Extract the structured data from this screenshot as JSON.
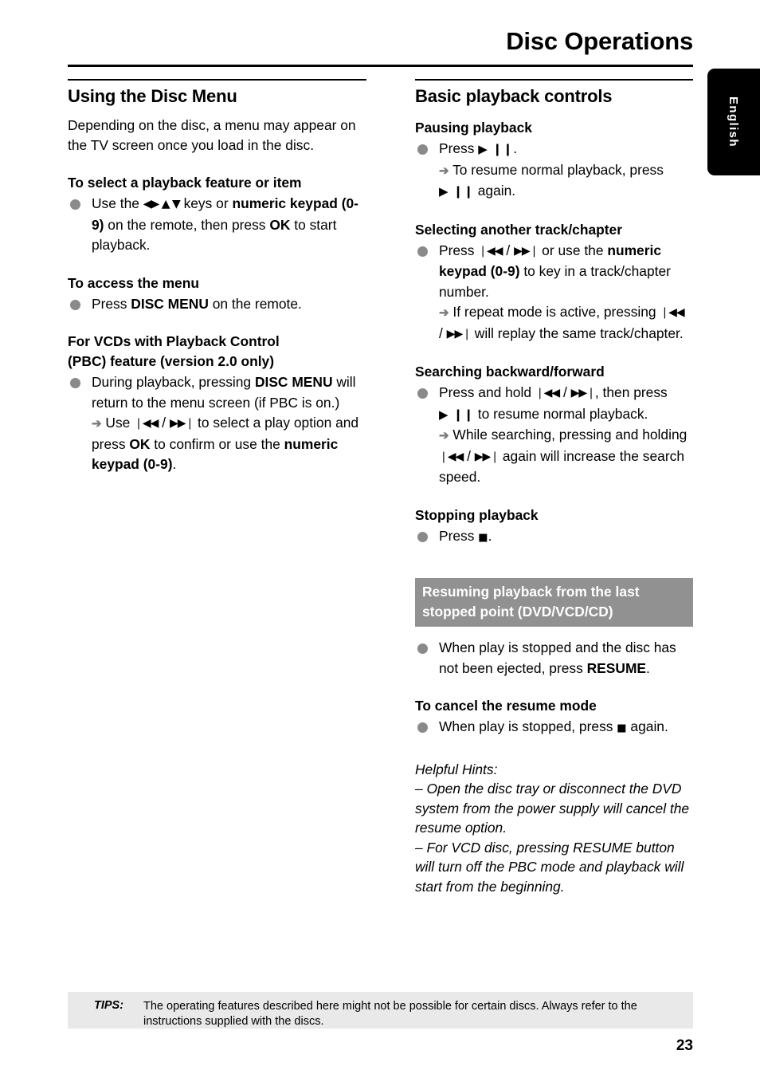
{
  "header": {
    "title": "Disc Operations"
  },
  "language_tab": {
    "label": "English"
  },
  "left_column": {
    "heading": "Using the Disc Menu",
    "intro": "Depending on the disc, a menu may appear on the TV screen once you load in the disc.",
    "sections": [
      {
        "heading": "To select a playback feature or item",
        "bullet_prefix": "Use the ",
        "keys_symbols": "◀▶ ▲ ▼",
        "bullet_mid": " keys or ",
        "bold_1": "numeric keypad (0-9)",
        "bullet_mid_2": " on the remote, then press ",
        "bold_2": "OK",
        "bullet_suffix": " to start playback."
      },
      {
        "heading": "To access the menu",
        "bullet_prefix": "Press ",
        "bold_1": "DISC MENU",
        "bullet_suffix": " on the remote."
      },
      {
        "heading_line_1": "For VCDs with Playback Control",
        "heading_line_2": "(PBC) feature (version 2.0 only)",
        "bullet_prefix": "During playback, pressing ",
        "bold_1": "DISC MENU",
        "bullet_mid": " will return to the menu screen (if PBC is on.)",
        "arrow": "➔",
        "arrow_text_1": " Use ",
        "sym_prev": "❘◀◀",
        "sym_sep": " / ",
        "sym_next": "▶▶❘",
        "arrow_text_2": " to select a play option and press ",
        "bold_2": "OK",
        "arrow_text_3": " to confirm or use the ",
        "bold_3": "numeric keypad (0-9)",
        "arrow_text_4": "."
      }
    ]
  },
  "right_column": {
    "heading": "Basic playback controls",
    "sections": [
      {
        "heading": "Pausing playback",
        "bullet_prefix": "Press ",
        "sym_playpause": "▶ ❙❙",
        "bullet_suffix": ".",
        "arrow": "➔",
        "arrow_text_1": " To resume normal playback, press ",
        "arrow_text_2": " again."
      },
      {
        "heading": "Selecting another track/chapter",
        "bullet_prefix": "Press ",
        "sym_prev": "❘◀◀",
        "sym_sep": " / ",
        "sym_next": "▶▶❘",
        "bullet_mid": " or use the ",
        "bold_1": "numeric keypad (0-9)",
        "bullet_mid_2": " to key in a track/chapter number.",
        "arrow": "➔",
        "arrow_text_1": " If repeat mode is active, pressing ",
        "arrow_text_2": " will replay the same track/chapter."
      },
      {
        "heading": "Searching backward/forward",
        "bullet_prefix": "Press and hold ",
        "sym_prev": "❘◀◀",
        "sym_sep": " / ",
        "sym_next": "▶▶❘",
        "bullet_mid": ", then press ",
        "sym_playpause": "▶ ❙❙",
        "bullet_mid_2": " to resume normal playback.",
        "arrow": "➔",
        "arrow_text_1": " While searching, pressing and holding ",
        "arrow_text_2": " again will increase the search speed."
      },
      {
        "heading": "Stopping playback",
        "bullet_prefix": "Press ",
        "sym_stop": "■",
        "bullet_suffix": "."
      }
    ],
    "gray_callout": {
      "line_1": "Resuming playback from the last",
      "line_2": "stopped point (DVD/VCD/CD)",
      "bg_color": "#919191",
      "text_color": "#ffffff"
    },
    "resume_bullet": {
      "prefix": "When play is stopped and the disc has not been ejected, press ",
      "bold_1": "RESUME",
      "suffix": "."
    },
    "cancel_resume": {
      "heading": "To cancel the resume mode",
      "prefix": "When play is stopped, press ",
      "sym_stop": "■",
      "suffix": " again."
    },
    "hints": {
      "title": "Helpful Hints:",
      "items": [
        "–  Open the disc tray or disconnect the DVD system from the power supply will cancel the resume option.",
        "–  For VCD disc, pressing RESUME button will turn off the PBC mode and playback will start from the beginning."
      ]
    }
  },
  "footer": {
    "tips_label": "TIPS:",
    "tips_text": "The operating features described here might not be possible for certain discs.  Always refer to the instructions supplied with the discs.",
    "page_number": "23"
  }
}
